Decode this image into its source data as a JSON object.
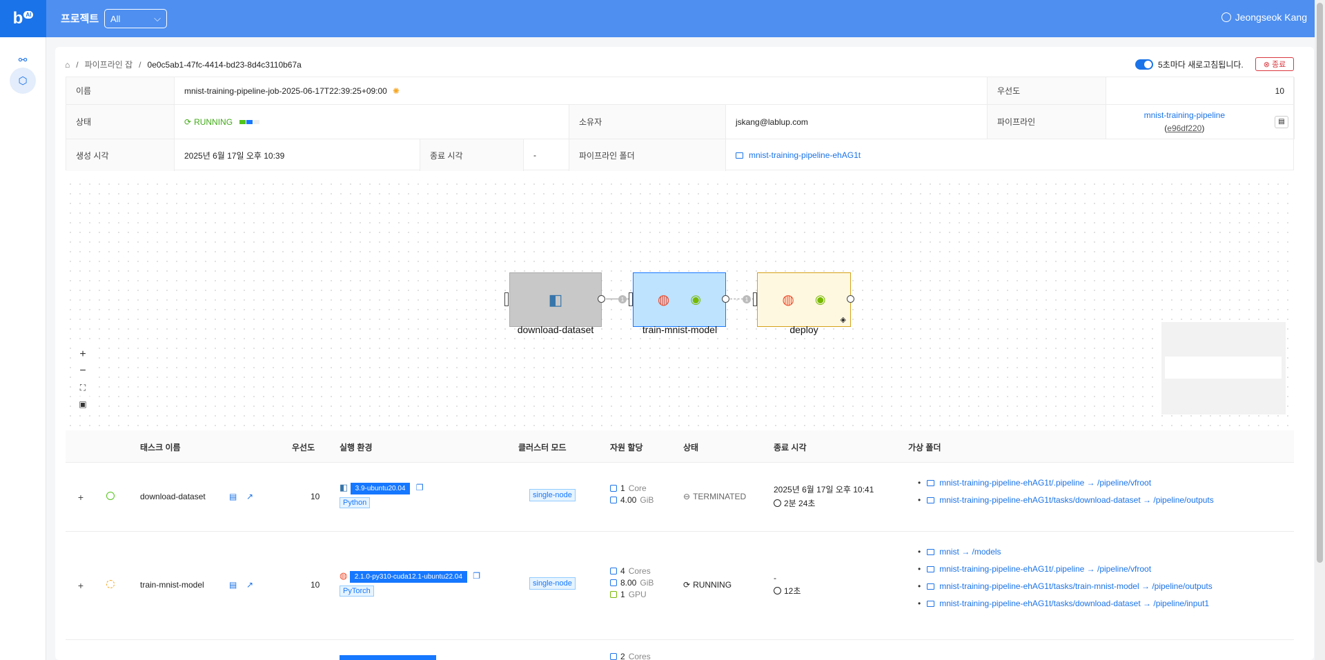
{
  "header": {
    "logo": "b",
    "logo_badge": "AI",
    "project_label": "프로젝트",
    "project_select": "All",
    "user_name": "Jeongseok Kang"
  },
  "breadcrumb": {
    "parent": "파이프라인 잡",
    "current": "0e0c5ab1-47fc-4414-bd23-8d4c3110b67a"
  },
  "refresh": {
    "label": "5초마다 새로고침됩니다.",
    "stop_label": "종료"
  },
  "details": {
    "name_label": "이름",
    "name": "mnist-training-pipeline-job-2025-06-17T22:39:25+09:00",
    "priority_label": "우선도",
    "priority": "10",
    "status_label": "상태",
    "status": "RUNNING",
    "owner_label": "소유자",
    "owner": "jskang@lablup.com",
    "pipeline_label": "파이프라인",
    "pipeline": "mnist-training-pipeline",
    "pipeline_hash": "e96df220",
    "created_label": "생성 시각",
    "created": "2025년 6월 17일 오후 10:39",
    "ended_label": "종료 시각",
    "ended": "-",
    "folder_label": "파이프라인 폴더",
    "folder": "mnist-training-pipeline-ehAG1t",
    "colors": {
      "running": "#41a917",
      "link": "#1a73e8"
    }
  },
  "graph": {
    "nodes": [
      {
        "label": "download-dataset",
        "color": "#c8c8c8"
      },
      {
        "label": "train-mnist-model",
        "color": "#bde3ff"
      },
      {
        "label": "deploy",
        "color": "#fff8e1"
      }
    ],
    "edge_badges": [
      "1",
      "1"
    ]
  },
  "table": {
    "headers": [
      "태스크 이름",
      "우선도",
      "실행 환경",
      "클러스터 모드",
      "자원 할당",
      "상태",
      "종료 시각",
      "가상 폴더"
    ],
    "rows": [
      {
        "name": "download-dataset",
        "priority": "10",
        "env": "3.9-ubuntu20.04",
        "lang": "Python",
        "mode": "single-node",
        "res": [
          {
            "n": "1",
            "u": "Core"
          },
          {
            "n": "4.00",
            "u": "GiB"
          }
        ],
        "status": "TERMINATED",
        "end": "2025년 6월 17일 오후 10:41",
        "duration": "2분 24초",
        "folders": [
          "mnist-training-pipeline-ehAG1t/.pipeline → /pipeline/vfroot",
          "mnist-training-pipeline-ehAG1t/tasks/download-dataset → /pipeline/outputs"
        ]
      },
      {
        "name": "train-mnist-model",
        "priority": "10",
        "env": "2.1.0-py310-cuda12.1-ubuntu22.04",
        "lang": "PyTorch",
        "mode": "single-node",
        "res": [
          {
            "n": "4",
            "u": "Cores"
          },
          {
            "n": "8.00",
            "u": "GiB"
          },
          {
            "n": "1",
            "u": "GPU"
          }
        ],
        "status": "RUNNING",
        "end": "-",
        "duration": "12초",
        "folders": [
          "mnist → /models",
          "mnist-training-pipeline-ehAG1t/.pipeline → /pipeline/vfroot",
          "mnist-training-pipeline-ehAG1t/tasks/train-mnist-model → /pipeline/outputs",
          "mnist-training-pipeline-ehAG1t/tasks/download-dataset → /pipeline/input1"
        ]
      },
      {
        "res": [
          {
            "n": "2",
            "u": "Cores"
          }
        ]
      }
    ]
  }
}
